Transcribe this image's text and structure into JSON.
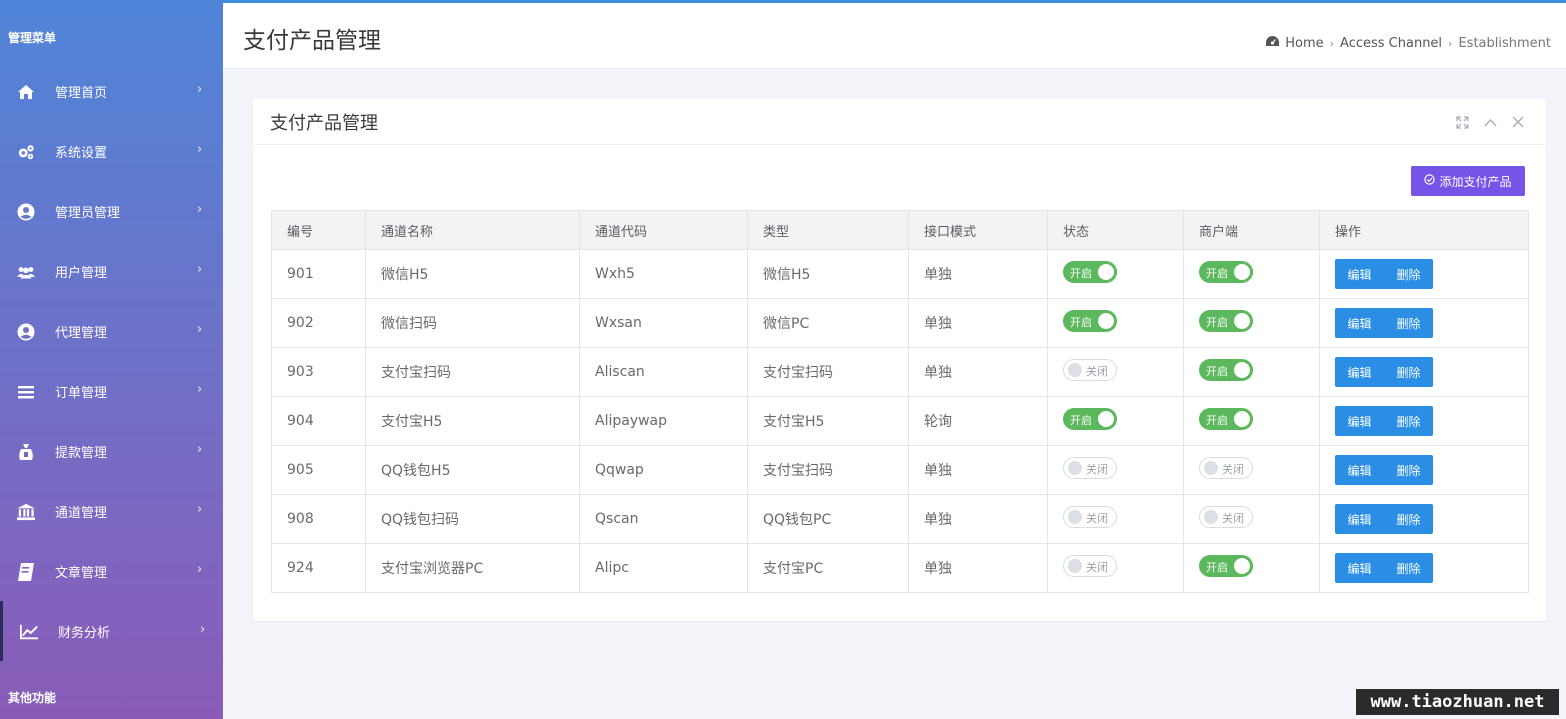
{
  "sidebar": {
    "top_heading": "管理菜单",
    "bottom_heading": "其他功能",
    "items": [
      {
        "label": "管理首页",
        "icon": "home-icon"
      },
      {
        "label": "系统设置",
        "icon": "gears-icon"
      },
      {
        "label": "管理员管理",
        "icon": "user-circle-icon"
      },
      {
        "label": "用户管理",
        "icon": "users-icon"
      },
      {
        "label": "代理管理",
        "icon": "user-circle-icon"
      },
      {
        "label": "订单管理",
        "icon": "list-icon"
      },
      {
        "label": "提款管理",
        "icon": "bag-icon"
      },
      {
        "label": "通道管理",
        "icon": "bank-icon"
      },
      {
        "label": "文章管理",
        "icon": "book-icon"
      },
      {
        "label": "财务分析",
        "icon": "line-chart-icon"
      }
    ]
  },
  "header": {
    "title": "支付产品管理",
    "breadcrumb": [
      "Home",
      "Access Channel",
      "Establishment"
    ]
  },
  "panel": {
    "title": "支付产品管理",
    "add_button": "添加支付产品"
  },
  "table": {
    "columns": [
      "编号",
      "通道名称",
      "通道代码",
      "类型",
      "接口模式",
      "状态",
      "商户端",
      "操作"
    ],
    "rows": [
      {
        "id": "901",
        "name": "微信H5",
        "code": "Wxh5",
        "type": "微信H5",
        "mode": "单独",
        "status": "开启",
        "merchant": "开启"
      },
      {
        "id": "902",
        "name": "微信扫码",
        "code": "Wxsan",
        "type": "微信PC",
        "mode": "单独",
        "status": "开启",
        "merchant": "开启"
      },
      {
        "id": "903",
        "name": "支付宝扫码",
        "code": "Aliscan",
        "type": "支付宝扫码",
        "mode": "单独",
        "status": "关闭",
        "merchant": "开启"
      },
      {
        "id": "904",
        "name": "支付宝H5",
        "code": "Alipaywap",
        "type": "支付宝H5",
        "mode": "轮询",
        "status": "开启",
        "merchant": "开启"
      },
      {
        "id": "905",
        "name": "QQ钱包H5",
        "code": "Qqwap",
        "type": "支付宝扫码",
        "mode": "单独",
        "status": "关闭",
        "merchant": "关闭"
      },
      {
        "id": "908",
        "name": "QQ钱包扫码",
        "code": "Qscan",
        "type": "QQ钱包PC",
        "mode": "单独",
        "status": "关闭",
        "merchant": "关闭"
      },
      {
        "id": "924",
        "name": "支付宝浏览器PC",
        "code": "Alipc",
        "type": "支付宝PC",
        "mode": "单独",
        "status": "关闭",
        "merchant": "开启"
      }
    ],
    "edit_label": "编辑",
    "delete_label": "删除"
  },
  "watermark": "www.tiaozhuan.net",
  "colors": {
    "accent": "#7754e8",
    "action": "#2a8ee4",
    "on": "#5cb85c"
  }
}
